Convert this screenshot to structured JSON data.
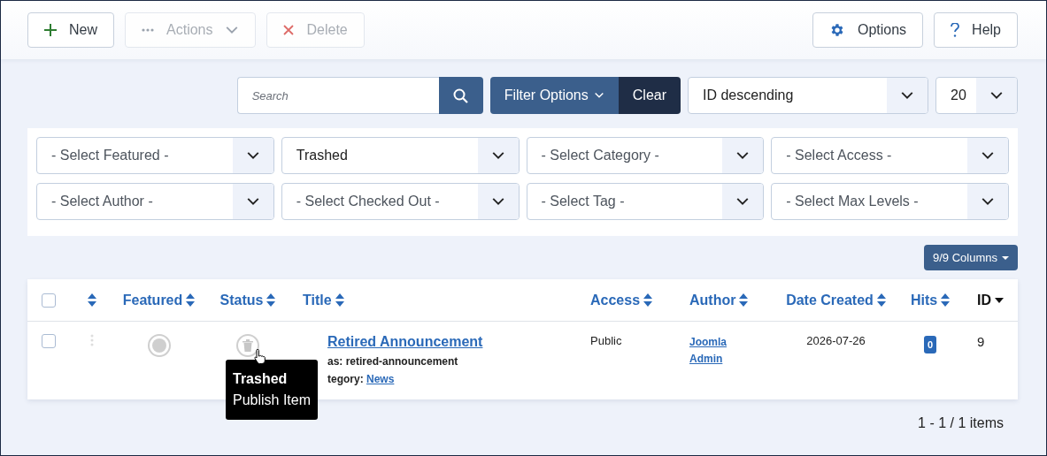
{
  "toolbar": {
    "left_buttons": [
      {
        "kind": "new",
        "label": "New",
        "disabled": false
      },
      {
        "kind": "actions",
        "label": "Actions",
        "disabled": true
      },
      {
        "kind": "delete",
        "label": "Delete",
        "disabled": true
      }
    ],
    "right_buttons": [
      {
        "kind": "options",
        "label": "Options"
      },
      {
        "kind": "help",
        "label": "Help"
      }
    ]
  },
  "search": {
    "placeholder": "Search"
  },
  "filter_button": {
    "label": "Filter Options"
  },
  "clear_button": {
    "label": "Clear"
  },
  "ordering": {
    "value": "ID descending"
  },
  "limit": {
    "value": "20"
  },
  "filters": [
    {
      "value": "- Select Featured -",
      "active": false
    },
    {
      "value": "Trashed",
      "active": true
    },
    {
      "value": "- Select Category -",
      "active": false
    },
    {
      "value": "- Select Access -",
      "active": false
    },
    {
      "value": "- Select Author -",
      "active": false
    },
    {
      "value": "- Select Checked Out -",
      "active": false
    },
    {
      "value": "- Select Tag -",
      "active": false
    },
    {
      "value": "- Select Max Levels -",
      "active": false
    }
  ],
  "columns_button": {
    "label": "9/9 Columns"
  },
  "table": {
    "columns": [
      {
        "kind": "checkbox",
        "checked": false
      },
      {
        "kind": "ordering",
        "sorted": false
      },
      {
        "kind": "sort",
        "label": "Featured",
        "sorted": false
      },
      {
        "kind": "sort",
        "label": "Status",
        "sorted": false
      },
      {
        "kind": "sort",
        "label": "Title",
        "sorted": false
      },
      {
        "kind": "sort",
        "label": "Access",
        "sorted": false
      },
      {
        "kind": "sort",
        "label": "Author",
        "sorted": false
      },
      {
        "kind": "sort",
        "label": "Date Created",
        "sorted": false
      },
      {
        "kind": "sort",
        "label": "Hits",
        "sorted": false
      },
      {
        "kind": "sort",
        "label": "ID",
        "sorted": true
      }
    ],
    "rows": [
      {
        "checked": false,
        "featured": false,
        "trashed": true,
        "title": "Retired Announcement",
        "alias": "as: retired-announcement",
        "category_label": "tegory:",
        "category": "News",
        "access": "Public",
        "author": "Joomla Admin",
        "date": "2026-07-26",
        "hits": "0",
        "id": "9"
      }
    ]
  },
  "tooltip": {
    "title": "Trashed",
    "text": "Publish Item"
  },
  "pagination": {
    "text": "1 - 1 / 1 items"
  }
}
